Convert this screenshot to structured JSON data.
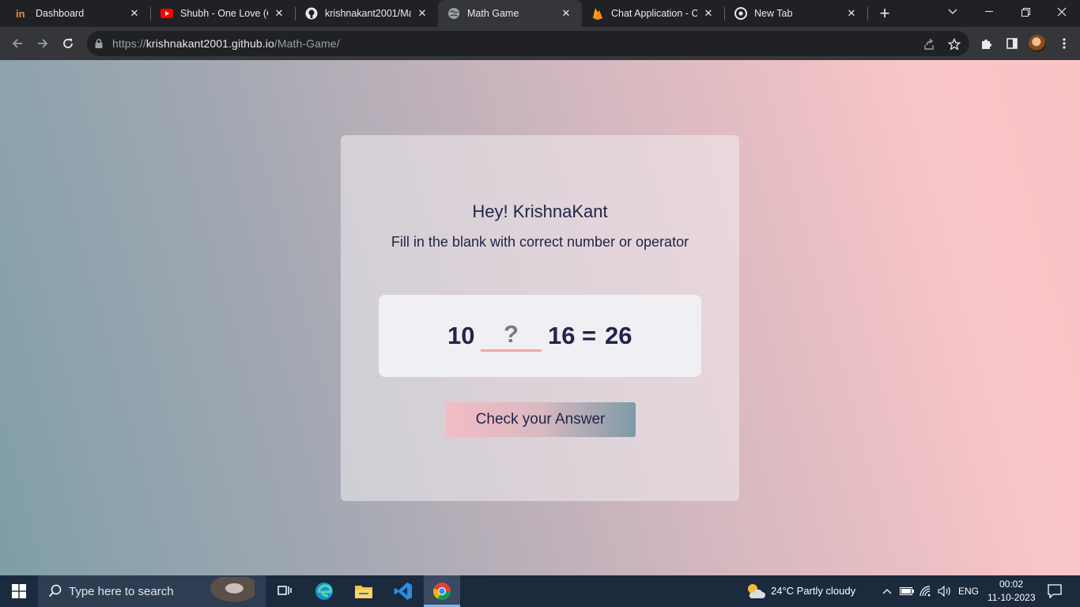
{
  "browser": {
    "tabs": [
      {
        "title": "Dashboard",
        "icon": "invision-icon"
      },
      {
        "title": "Shubh - One Love (Of",
        "icon": "youtube-icon"
      },
      {
        "title": "krishnakant2001/Mat",
        "icon": "github-icon"
      },
      {
        "title": "Math Game",
        "icon": "globe-icon",
        "active": true
      },
      {
        "title": "Chat Application - Cl",
        "icon": "firebase-icon"
      },
      {
        "title": "New Tab",
        "icon": "chrome-icon"
      }
    ],
    "url_scheme": "https://",
    "url_host": "krishnakant2001.github.io",
    "url_path": "/Math-Game/"
  },
  "game": {
    "greeting": "Hey! KrishnaKant",
    "instruction": "Fill in the blank with correct number or operator",
    "operand_left": "10",
    "blank_placeholder": "?",
    "operand_right": "16",
    "equals": "=",
    "result": "26",
    "button_label": "Check your Answer"
  },
  "taskbar": {
    "search_placeholder": "Type here to search",
    "weather": "24°C  Partly cloudy",
    "language": "ENG",
    "time": "00:02",
    "date": "11-10-2023"
  },
  "colors": {
    "text": "#22244a",
    "underline": "#f0a8ad",
    "gradient_left": "#7f9ea8",
    "gradient_right": "#f9c3c6"
  }
}
